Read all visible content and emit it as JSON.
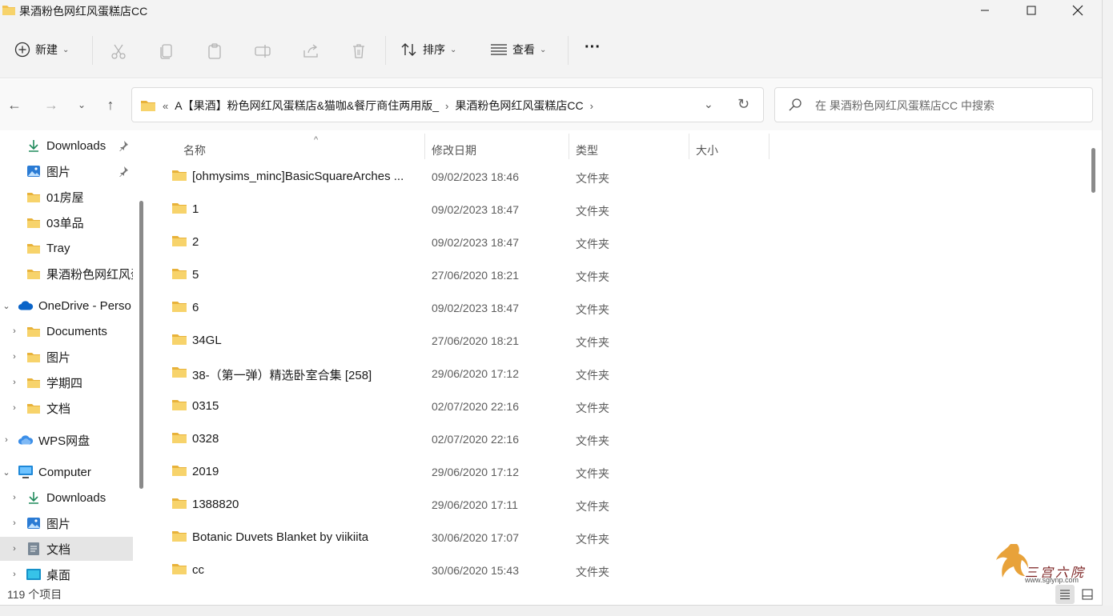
{
  "window": {
    "title": "果酒粉色网红风蛋糕店CC"
  },
  "toolbar": {
    "new_label": "新建",
    "sort_label": "排序",
    "view_label": "查看",
    "more_label": "···"
  },
  "address": {
    "overflow": "«",
    "crumbs": [
      "A【果酒】粉色网红风蛋糕店&猫咖&餐厅商住两用版_",
      "果酒粉色网红风蛋糕店CC"
    ]
  },
  "search": {
    "placeholder": "在 果酒粉色网红风蛋糕店CC 中搜索"
  },
  "sidebar": {
    "items": [
      {
        "label": "Downloads",
        "icon": "download-icon",
        "pinned": true
      },
      {
        "label": "图片",
        "icon": "pictures-icon",
        "pinned": true
      },
      {
        "label": "01房屋",
        "icon": "folder-icon"
      },
      {
        "label": "03单品",
        "icon": "folder-icon"
      },
      {
        "label": "Tray",
        "icon": "folder-icon"
      },
      {
        "label": "果酒粉色网红风蛋",
        "icon": "folder-icon"
      },
      {
        "label": "OneDrive - Perso",
        "icon": "cloud-icon"
      },
      {
        "label": "Documents",
        "icon": "folder-icon"
      },
      {
        "label": "图片",
        "icon": "folder-icon"
      },
      {
        "label": "学期四",
        "icon": "folder-icon"
      },
      {
        "label": "文档",
        "icon": "folder-icon"
      },
      {
        "label": "WPS网盘",
        "icon": "wps-cloud-icon"
      },
      {
        "label": "Computer",
        "icon": "computer-icon"
      },
      {
        "label": "Downloads",
        "icon": "download-icon"
      },
      {
        "label": "图片",
        "icon": "pictures-icon"
      },
      {
        "label": "文档",
        "icon": "document-icon"
      },
      {
        "label": "桌面",
        "icon": "desktop-icon"
      }
    ]
  },
  "columns": {
    "name": "名称",
    "modified": "修改日期",
    "type": "类型",
    "size": "大小"
  },
  "files": [
    {
      "name": "[ohmysims_minc]BasicSquareArches ...",
      "date": "09/02/2023 18:46",
      "type": "文件夹"
    },
    {
      "name": "1",
      "date": "09/02/2023 18:47",
      "type": "文件夹"
    },
    {
      "name": "2",
      "date": "09/02/2023 18:47",
      "type": "文件夹"
    },
    {
      "name": "5",
      "date": "27/06/2020 18:21",
      "type": "文件夹"
    },
    {
      "name": "6",
      "date": "09/02/2023 18:47",
      "type": "文件夹"
    },
    {
      "name": "34GL",
      "date": "27/06/2020 18:21",
      "type": "文件夹"
    },
    {
      "name": "38-（第一弹）精选卧室合集 [258]",
      "date": "29/06/2020 17:12",
      "type": "文件夹"
    },
    {
      "name": "0315",
      "date": "02/07/2020 22:16",
      "type": "文件夹"
    },
    {
      "name": "0328",
      "date": "02/07/2020 22:16",
      "type": "文件夹"
    },
    {
      "name": "2019",
      "date": "29/06/2020 17:12",
      "type": "文件夹"
    },
    {
      "name": "1388820",
      "date": "29/06/2020 17:11",
      "type": "文件夹"
    },
    {
      "name": "Botanic Duvets Blanket by viikiita",
      "date": "30/06/2020 17:07",
      "type": "文件夹"
    },
    {
      "name": "cc",
      "date": "30/06/2020 15:43",
      "type": "文件夹"
    }
  ],
  "status": {
    "count": "119 个项目"
  },
  "watermark": {
    "text": "三宫六院",
    "url": "www.sglynp.com"
  },
  "colors": {
    "folder": "#f2c14e",
    "accent": "#0067c0",
    "selected": "#e5e5e5"
  }
}
